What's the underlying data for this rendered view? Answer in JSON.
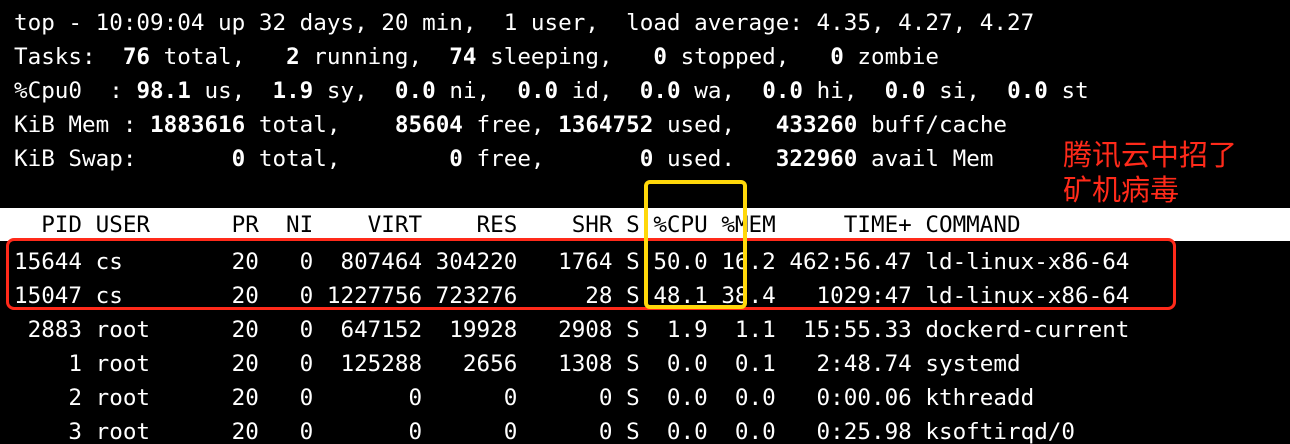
{
  "summary": {
    "uptime_line": "top - 10:09:04 up 32 days, 20 min,  1 user,  load average: 4.35, 4.27, 4.27",
    "tasks": {
      "label": "Tasks: ",
      "total": " 76",
      "total_label": " total, ",
      "running": "  2",
      "running_label": " running, ",
      "sleeping": " 74",
      "sleeping_label": " sleeping, ",
      "stopped": "  0",
      "stopped_label": " stopped, ",
      "zombie": "  0",
      "zombie_label": " zombie"
    },
    "cpu": {
      "label": "%Cpu0  : ",
      "us": "98.1",
      "us_label": " us, ",
      "sy": " 1.9",
      "sy_label": " sy, ",
      "ni": " 0.0",
      "ni_label": " ni, ",
      "id": " 0.0",
      "id_label": " id, ",
      "wa": " 0.0",
      "wa_label": " wa, ",
      "hi": " 0.0",
      "hi_label": " hi, ",
      "si": " 0.0",
      "si_label": " si, ",
      "st": " 0.0",
      "st_label": " st"
    },
    "mem": {
      "label": "KiB Mem : ",
      "total": "1883616",
      "total_label": " total, ",
      "free": "   85604",
      "free_label": " free, ",
      "used": "1364752",
      "used_label": " used, ",
      "buff_cache": "  433260",
      "buff_cache_label": " buff/cache"
    },
    "swap": {
      "label": "KiB Swap: ",
      "total": "      0",
      "total_label": " total, ",
      "free": "       0",
      "free_label": " free, ",
      "used": "      0",
      "used_label": " used. ",
      "avail": "  322960",
      "avail_label": " avail Mem"
    }
  },
  "process_header": "  PID USER      PR  NI    VIRT    RES    SHR S %CPU %MEM     TIME+ COMMAND",
  "processes": [
    "15644 cs        20   0  807464 304220   1764 S 50.0 16.2 462:56.47 ld-linux-x86-64",
    "15047 cs        20   0 1227756 723276     28 S 48.1 38.4   1029:47 ld-linux-x86-64",
    " 2883 root      20   0  647152  19928   2908 S  1.9  1.1  15:55.33 dockerd-current",
    "    1 root      20   0  125288   2656   1308 S  0.0  0.1   2:48.74 systemd",
    "    2 root      20   0       0      0      0 S  0.0  0.0   0:00.06 kthreadd",
    "    3 root      20   0       0      0      0 S  0.0  0.0   0:25.98 ksoftirqd/0"
  ],
  "annotation": {
    "text": "腾讯云中招了\n矿机病毒",
    "color": "#ff2a1a"
  },
  "colors": {
    "background": "#000000",
    "foreground": "#ffffff",
    "highlight_red": "#ff2a1a",
    "highlight_yellow": "#ffd80a"
  }
}
